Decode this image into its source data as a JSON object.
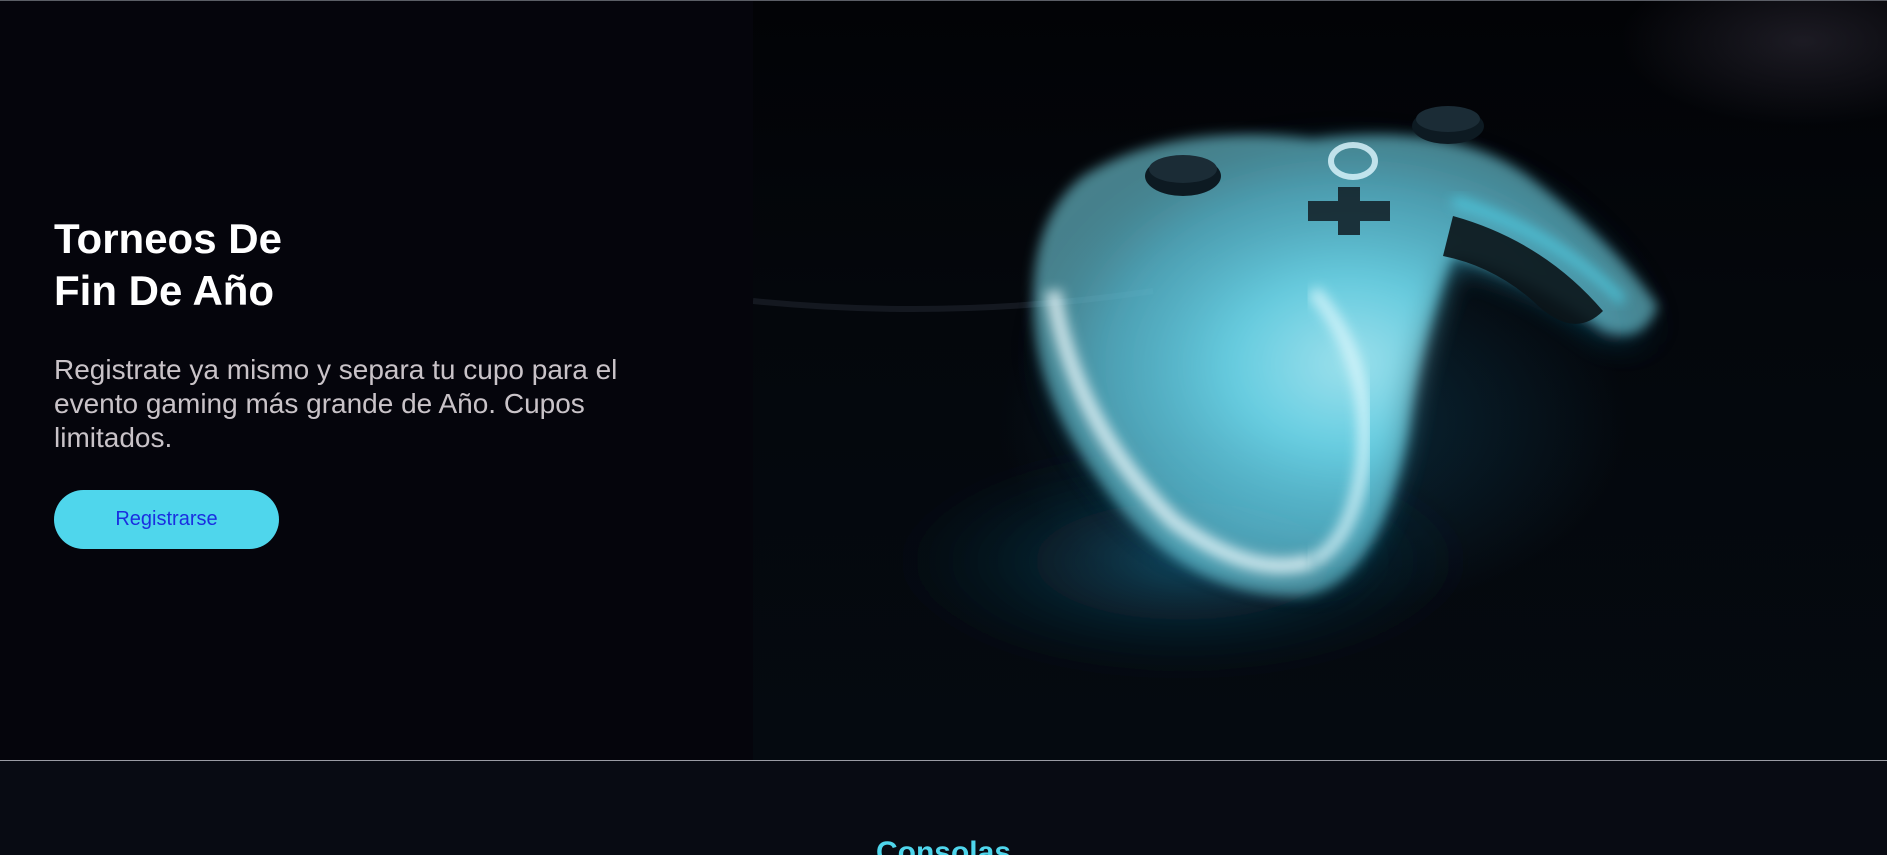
{
  "hero": {
    "title_line1": "Torneos De",
    "title_line2": "Fin De Año",
    "description": "Registrate ya mismo y separa tu cupo para el evento gaming más grande de Año. Cupos limitados.",
    "cta_label": "Registrarse",
    "image_icon": "glowing-gamepad-photo"
  },
  "section": {
    "title": "Consolas"
  },
  "colors": {
    "accent": "#4fd6ec",
    "button_text": "#1a2fe0",
    "background": "#05050c",
    "title_text": "#ffffff",
    "body_text": "#c9c3c8"
  }
}
